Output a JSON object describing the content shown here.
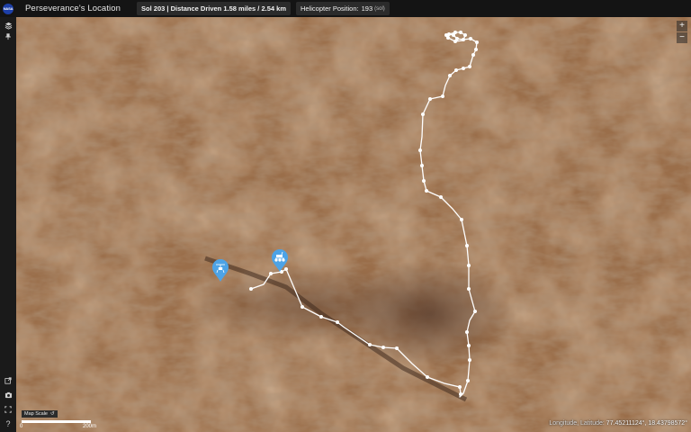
{
  "header": {
    "title": "Perseverance's Location",
    "sol_text": "Sol 203 | Distance Driven 1.58 miles / 2.54 km",
    "heli_label": "Helicopter Position:",
    "heli_value": "193",
    "heli_unit": "(sol)"
  },
  "logo": {
    "text": "NASA"
  },
  "toolbar": {
    "layers_icon": "layers-icon",
    "pin_icon": "pin-icon",
    "share_icon": "share-icon",
    "camera_icon": "camera-icon",
    "fullscreen_icon": "fullscreen-icon",
    "help_icon": "help-icon",
    "help_glyph": "?"
  },
  "zoom": {
    "in": "+",
    "out": "−"
  },
  "scale": {
    "label": "Map Scale",
    "zero": "0",
    "max": "200m",
    "reset_glyph": "↺"
  },
  "coordinates": {
    "label": "Longitude, Latitude:",
    "value": "77.45211124°, 18.43798572°"
  },
  "markers": {
    "helicopter": "helicopter-marker",
    "rover": "rover-marker"
  },
  "colors": {
    "ground_base": "#9a6e4a",
    "ground_dark": "#6b4a33",
    "ground_light": "#b58a62",
    "route": "#ffffff",
    "marker": "#4da3e6"
  }
}
